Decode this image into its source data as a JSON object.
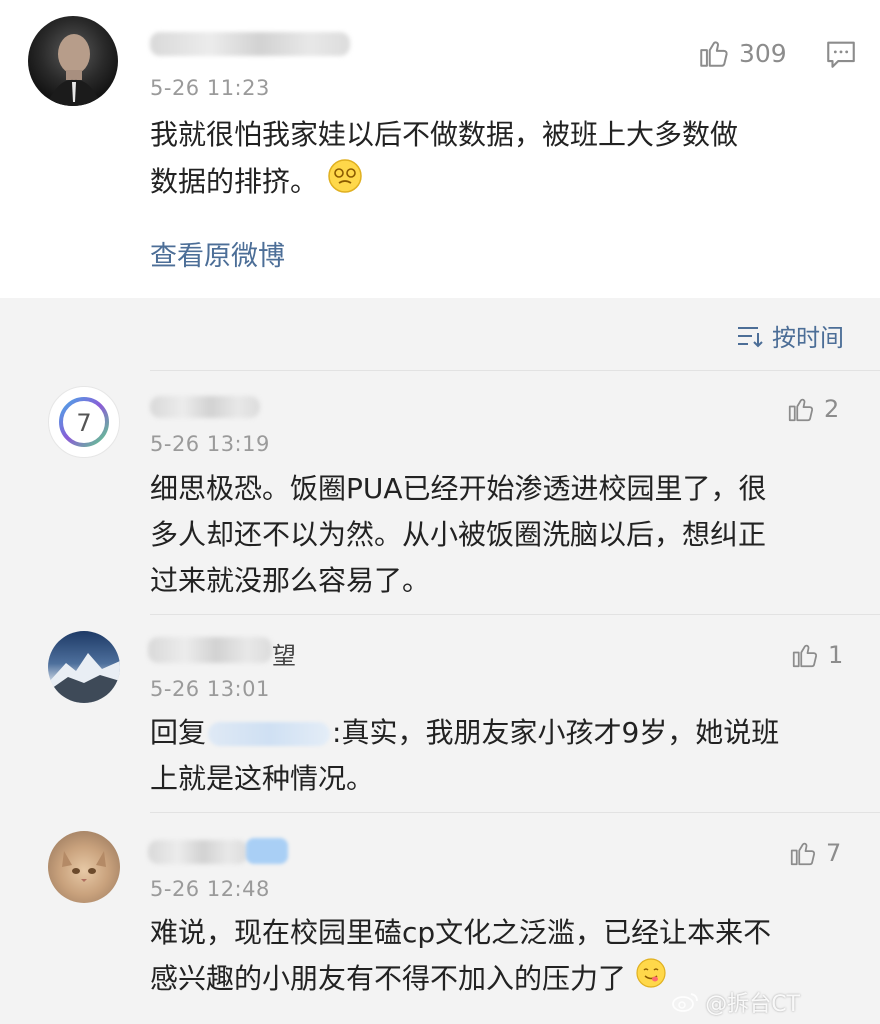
{
  "post": {
    "time": "5-26 11:23",
    "like_count": "309",
    "text_line1": "我就很怕我家娃以后不做数据，被班上大多数做",
    "text_line2": "数据的排挤。",
    "view_original": "查看原微博"
  },
  "sort": {
    "label": "按时间"
  },
  "comments": [
    {
      "time": "5-26 13:19",
      "likes": "2",
      "lines": [
        "细思极恐。饭圈PUA已经开始渗透进校园里了，很",
        "多人却还不以为然。从小被饭圈洗脑以后，想纠正",
        "过来就没那么容易了。"
      ],
      "avatar_badge": "7"
    },
    {
      "time": "5-26 13:01",
      "likes": "1",
      "reply_prefix": "回复",
      "line1_rest": ":真实，我朋友家小孩才9岁，她说班",
      "line2": "上就是这种情况。",
      "name_tail": "望"
    },
    {
      "time": "5-26 12:48",
      "likes": "7",
      "lines": [
        "难说，现在校园里磕cp文化之泛滥，已经让本来不",
        "感兴趣的小朋友有不得不加入的压力了"
      ]
    }
  ],
  "watermark": "@拆台CT",
  "icons": {
    "like": "thumbs-up-icon",
    "comment": "comment-icon",
    "sort": "sort-icon"
  }
}
